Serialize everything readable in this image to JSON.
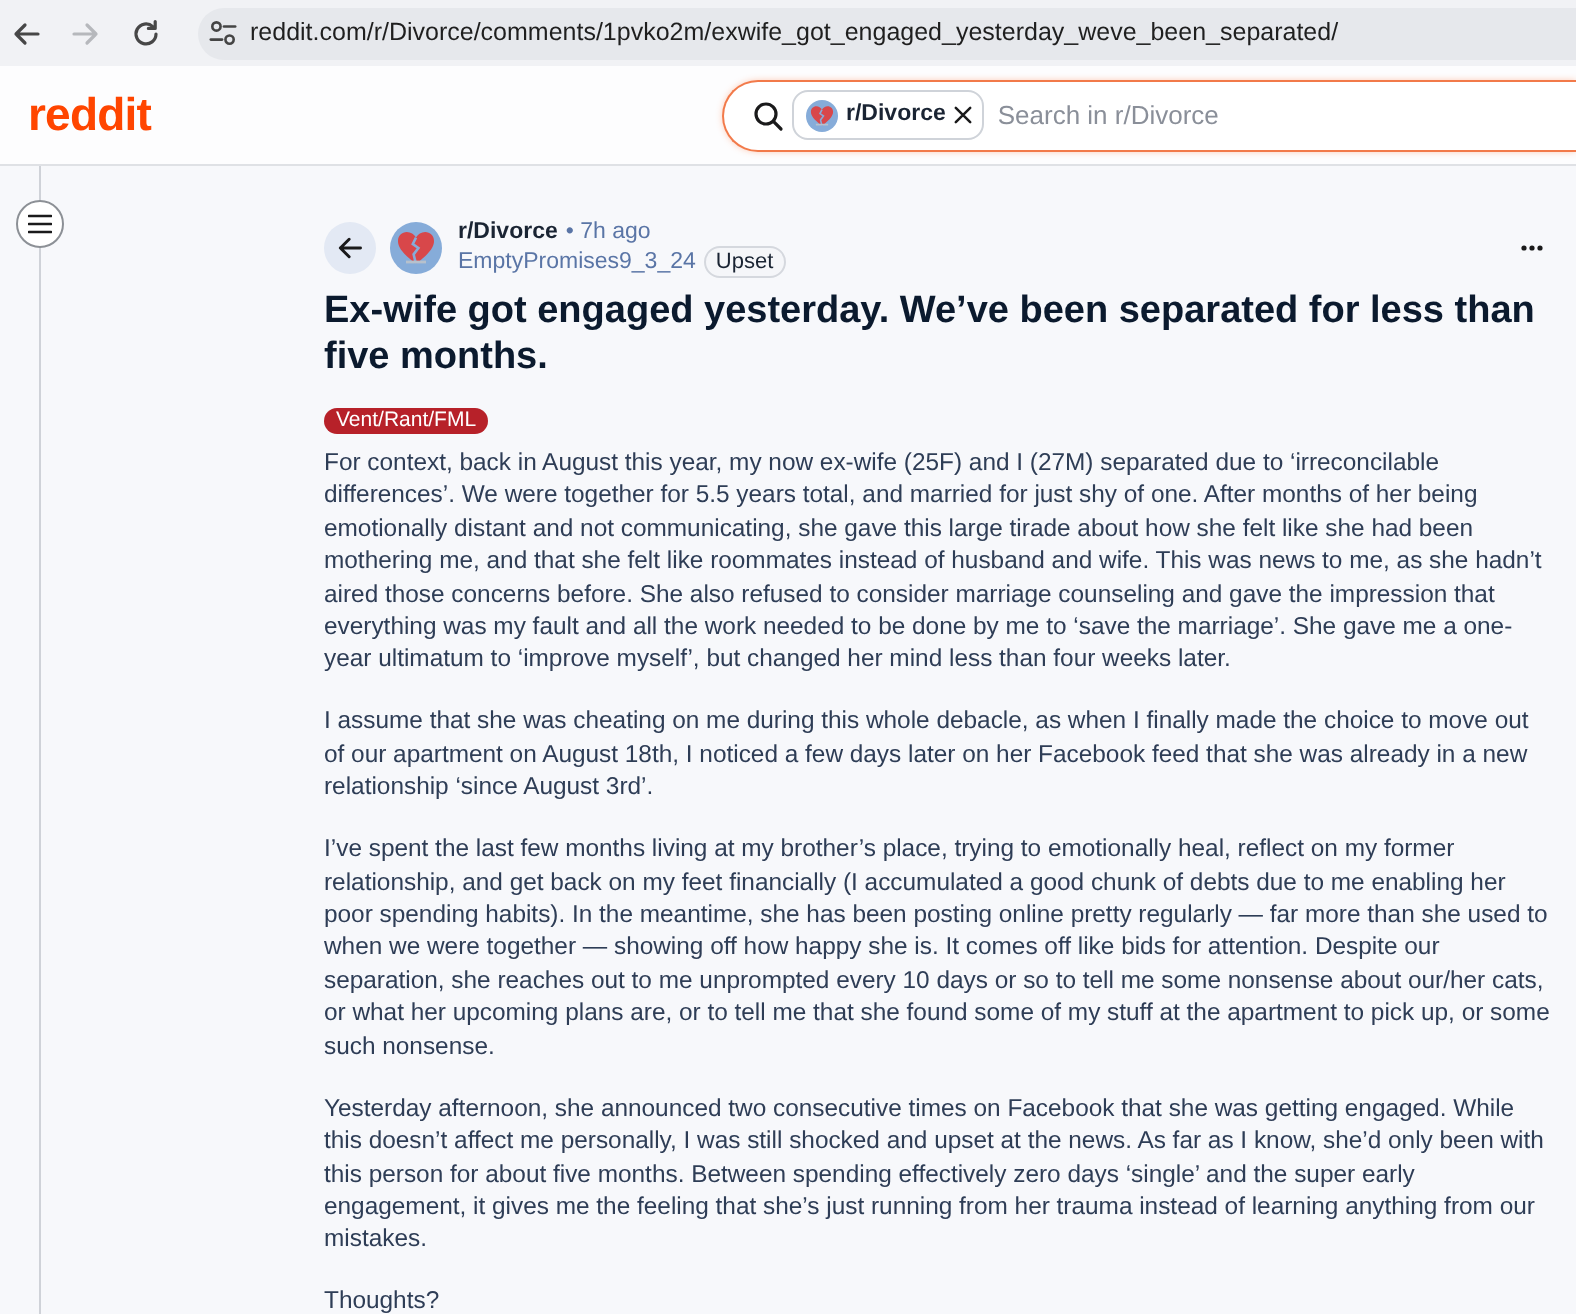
{
  "browser": {
    "buttons": [
      {
        "kind": "back",
        "disabled": false
      },
      {
        "kind": "forward",
        "disabled": true
      },
      {
        "kind": "reload",
        "disabled": false
      }
    ],
    "url": "reddit.com/r/Divorce/comments/1pvko2m/exwife_got_engaged_yesterday_weve_been_separated/"
  },
  "header": {
    "logo": "reddit",
    "search": {
      "scope": "r/Divorce",
      "placeholder": "Search in r/Divorce"
    }
  },
  "post": {
    "subreddit": "r/Divorce",
    "time": "• 7h ago",
    "author": "EmptyPromises9_3_24",
    "user_flair": "Upset",
    "title": "Ex-wife got engaged yesterday. We’ve been separated for less than five months.",
    "flair": "Vent/Rant/FML",
    "paragraphs": [
      "For context, back in August this year, my now ex-wife (25F) and I (27M) separated due to ‘irreconcilable differences’. We were together for 5.5 years total, and married for just shy of one. After months of her being emotionally distant and not communicating, she gave this large tirade about how she felt like she had been mothering me, and that she felt like roommates instead of husband and wife. This was news to me, as she hadn’t aired those concerns before. She also refused to consider marriage counseling and gave the impression that everything was my fault and all the work needed to be done by me to ‘save the marriage’. She gave me a one-year ultimatum to ‘improve myself’, but changed her mind less than four weeks later.",
      "I assume that she was cheating on me during this whole debacle, as when I finally made the choice to move out of our apartment on August 18th, I noticed a few days later on her Facebook feed that she was already in a new relationship ‘since August 3rd’.",
      "I’ve spent the last few months living at my brother’s place, trying to emotionally heal, reflect on my former relationship, and get back on my feet financially (I accumulated a good chunk of debts due to me enabling her poor spending habits). In the meantime, she has been posting online pretty regularly — far more than she used to when we were together — showing off how happy she is. It comes off like bids for attention. Despite our separation, she reaches out to me unprompted every 10 days or so to tell me some nonsense about our/her cats, or what her upcoming plans are, or to tell me that she found some of my stuff at the apartment to pick up, or some such nonsense.",
      "Yesterday afternoon, she announced two consecutive times on Facebook that she was getting engaged. While this doesn’t affect me personally, I was still shocked and upset at the news. As far as I know, she’d only been with this person for about five months. Between spending effectively zero days ‘single’ and the super early engagement, it gives me the feeling that she’s just running from her trauma instead of learning anything from our mistakes.",
      "Thoughts?"
    ]
  }
}
